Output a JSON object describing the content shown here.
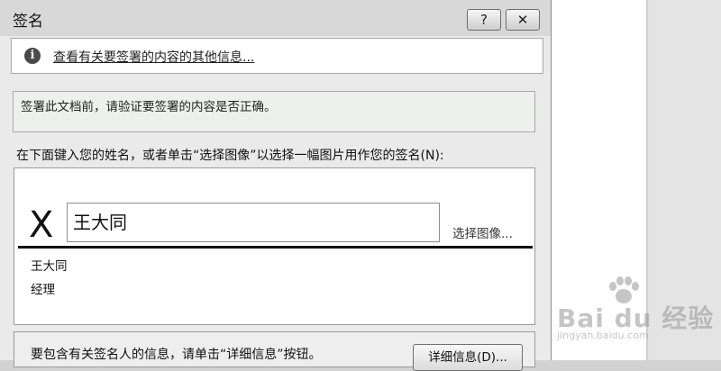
{
  "dialog": {
    "title": "签名",
    "help_button": "?",
    "close_button": "✕",
    "info": {
      "icon": "info-icon",
      "icon_glyph": "i",
      "link": "查看有关要签署的内容的其他信息..."
    },
    "verify_text": "签署此文档前，请验证要签署的内容是否正确。",
    "prompt": "在下面键入您的姓名，或者单击“选择图像”以选择一幅图片用作您的签名(N):",
    "signature": {
      "x_mark": "X",
      "input_value": "王大同",
      "select_image_link": "选择图像...",
      "signer_name": "王大同",
      "signer_title": "经理"
    },
    "bottom": {
      "text": "要包含有关签名人的信息，请单击“详细信息”按钮。",
      "details_button": "详细信息(D)..."
    }
  },
  "watermark": {
    "main": "Bai du 经验",
    "url": "jingyan.baidu.com"
  },
  "colors": {
    "dialog_bg": "#eaeaea",
    "titlebar_bg": "#d8d8d8",
    "document_bg": "#ffffff"
  }
}
